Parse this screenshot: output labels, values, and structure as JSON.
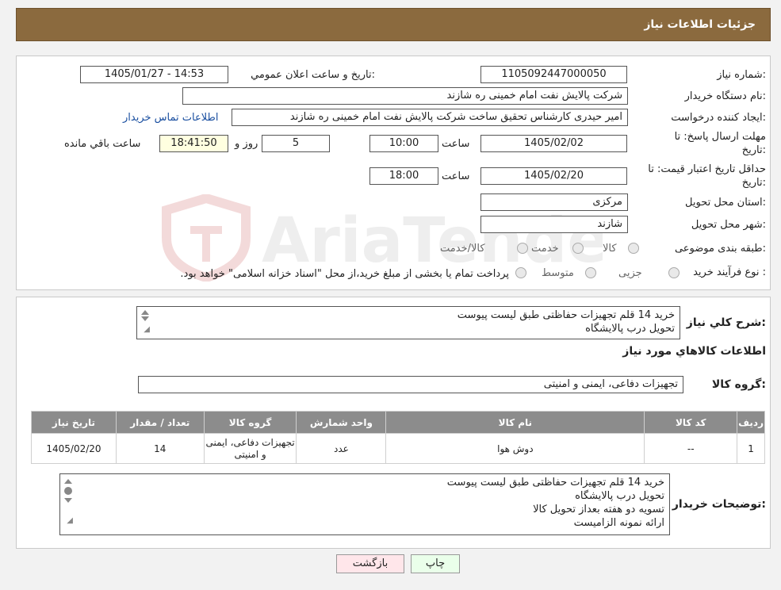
{
  "header": {
    "title": "جزئیات اطلاعات نیاز"
  },
  "form": {
    "need_number_label": "شماره نیاز:",
    "need_number": "1105092447000050",
    "announce_label": "تاریخ و ساعت اعلان عمومي:",
    "announce_value": "1405/01/27 - 14:53",
    "buyer_org_label": "نام دستگاه خریدار:",
    "buyer_org": "شرکت پالایش نفت امام خمینی  ره  شازند",
    "creator_label": "ایجاد کننده درخواست:",
    "creator": "امیر  حیدری کارشناس تحقیق ساخت شرکت پالایش نفت امام خمینی  ره  شازند",
    "contact_link": "اطلاعات تماس خریدار",
    "deadline_label_line1": "مهلت ارسال پاسخ: تا",
    "deadline_label_line2": "تاریخ:",
    "deadline_date": "1405/02/02",
    "time_label": "ساعت",
    "deadline_time": "10:00",
    "days": "5",
    "days_label": "روز و",
    "remaining_time": "18:41:50",
    "remaining_label": "ساعت باقي مانده",
    "validity_label_line1": "حداقل تاريخ اعتبار قیمت: تا",
    "validity_label_line2": "تاریخ:",
    "validity_date": "1405/02/20",
    "validity_time": "18:00",
    "province_label": "استان محل تحویل:",
    "province": "مرکزی",
    "city_label": "شهر محل تحویل:",
    "city": "شازند",
    "category_label": "طبقه بندی موضوعی:",
    "category_options": [
      "کالا",
      "خدمت",
      "کالا/خدمت"
    ],
    "process_label": "نوع فرآیند خرید :",
    "process_options": [
      "جزیی",
      "متوسط"
    ],
    "process_note": "پرداخت تمام یا بخشی از مبلغ خرید،از محل \"اسناد خزانه اسلامی\" خواهد بود."
  },
  "details": {
    "summary_label": "شرح کلي نياز:",
    "summary_lines": [
      "خرید 14 قلم تجهیزات حفاظتی طبق لیست پیوست",
      "تحویل درب پالایشگاه"
    ],
    "goods_info_title": "اطلاعات کالاهاي مورد نياز",
    "goods_group_label": "گروه کالا:",
    "goods_group": "تجهیزات دفاعی، ایمنی و امنیتی",
    "table": {
      "headers": [
        "رديف",
        "کد کالا",
        "نام کالا",
        "واحد شمارش",
        "گروه کالا",
        "تعداد / مقدار",
        "تاریخ نیاز"
      ],
      "rows": [
        [
          "1",
          "--",
          "دوش هوا",
          "عدد",
          "تجهیزات دفاعی، ایمنی و امنیتی",
          "14",
          "1405/02/20"
        ]
      ]
    },
    "buyer_notes_label": "توضیحات خریدار:",
    "buyer_notes_lines": [
      "خرید 14 قلم تجهیزات حفاظتی طبق لیست پیوست",
      "تحویل درب پالایشگاه",
      "تسویه دو هفته بعداز تحویل کالا",
      "ارائه نمونه الزامیست"
    ]
  },
  "buttons": {
    "print": "چاپ",
    "back": "بازگشت"
  },
  "watermark": {
    "text": "AriaTender.neT"
  },
  "colors": {
    "header_bg": "#8b6a3e",
    "table_header_bg": "#8c8c8c",
    "print_btn_bg": "#eaffea",
    "back_btn_bg": "#ffe6ea",
    "link": "#1a4fa0"
  }
}
